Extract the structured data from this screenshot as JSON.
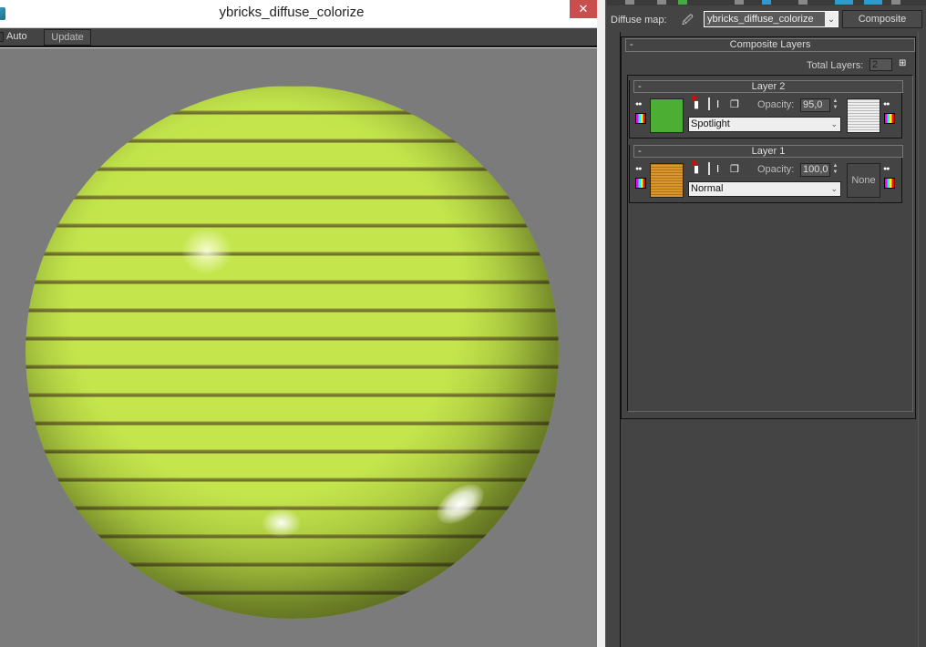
{
  "preview": {
    "title": "ybricks_diffuse_colorize",
    "close_glyph": "✕",
    "auto_label": "Auto",
    "auto_checked": false,
    "update_label": "Update"
  },
  "panel": {
    "diffuse_label": "Diffuse map:",
    "eyedropper_glyph": "🖉",
    "map_name": "ybricks_diffuse_colorize",
    "dropdown_glyph": "⌄",
    "map_type_button": "Composite",
    "rollout_title": "Composite Layers",
    "collapse_glyph": "-",
    "total_layers_label": "Total Layers:",
    "total_layers_value": "2",
    "add_layer_glyph": "⊞"
  },
  "layers": [
    {
      "name": "Layer 2",
      "opacity": "95,0",
      "blend_mode": "Spotlight",
      "swatch_color": "#4caf33",
      "mask": "texture",
      "mask_label": ""
    },
    {
      "name": "Layer 1",
      "opacity": "100,0",
      "blend_mode": "Normal",
      "swatch_color": "#c98a24",
      "mask": "none",
      "mask_label": "None"
    }
  ],
  "labels": {
    "opacity": "Opacity:",
    "eye_glyph": "●●",
    "delete_glyph": "▮",
    "delete_x": "✖",
    "duplicate_glyph": "Ⅰ",
    "copy_glyph": "❐",
    "spin_up": "▲",
    "spin_down": "▼",
    "arrow": "⌄"
  },
  "colors": {
    "sphere_base": "#c4e64c",
    "viewport_bg": "#7b7b7b",
    "panel_bg": "#444444",
    "close_btn": "#c94f4f"
  }
}
